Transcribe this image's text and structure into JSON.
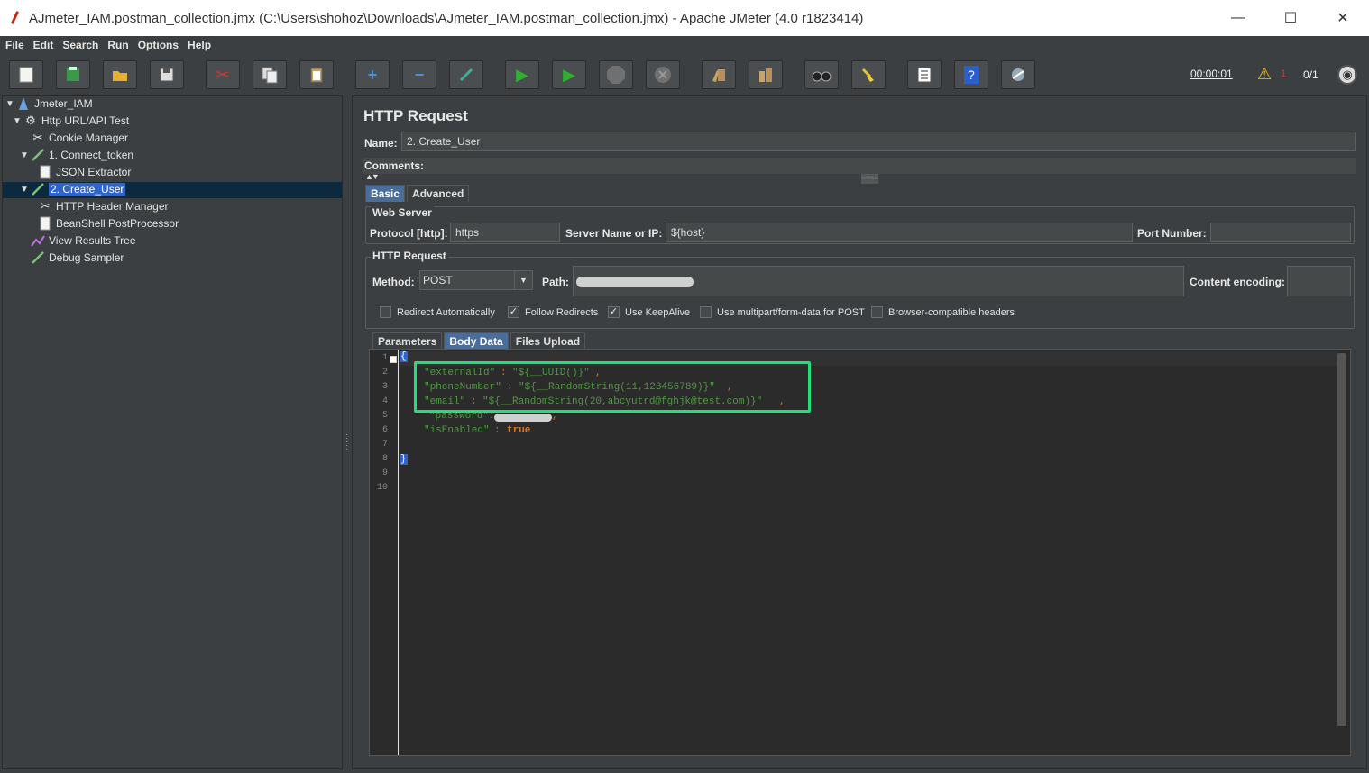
{
  "window": {
    "title": "AJmeter_IAM.postman_collection.jmx (C:\\Users\\shohoz\\Downloads\\AJmeter_IAM.postman_collection.jmx) - Apache JMeter (4.0 r1823414)",
    "minimize": "—",
    "maximize": "☐",
    "close": "✕"
  },
  "menu": [
    "File",
    "Edit",
    "Search",
    "Run",
    "Options",
    "Help"
  ],
  "toolbar": {
    "timer": "00:00:01",
    "error_count": "1",
    "threads": "0/1"
  },
  "tree": {
    "items": [
      {
        "label": "Jmeter_IAM",
        "icon": "testplan-icon"
      },
      {
        "label": "Http URL/API Test",
        "icon": "threadgroup-gear-icon"
      },
      {
        "label": "Cookie Manager",
        "icon": "config-scissors-icon"
      },
      {
        "label": "1. Connect_token",
        "icon": "sampler-pipette-icon"
      },
      {
        "label": "JSON Extractor",
        "icon": "postprocessor-doc-icon"
      },
      {
        "label": "2. Create_User",
        "icon": "sampler-pipette-icon"
      },
      {
        "label": "HTTP Header Manager",
        "icon": "config-scissors-icon"
      },
      {
        "label": "BeanShell PostProcessor",
        "icon": "postprocessor-doc-icon"
      },
      {
        "label": "View Results Tree",
        "icon": "listener-chart-icon"
      },
      {
        "label": "Debug Sampler",
        "icon": "sampler-pipette-icon"
      }
    ]
  },
  "panel": {
    "title": "HTTP Request",
    "name_label": "Name:",
    "name_value": "2. Create_User",
    "comments_label": "Comments:",
    "tabs": [
      "Basic",
      "Advanced"
    ],
    "web_server": {
      "title": "Web Server",
      "protocol_label": "Protocol [http]:",
      "protocol_value": "https",
      "server_label": "Server Name or IP:",
      "server_value": "${host}",
      "port_label": "Port Number:",
      "port_value": ""
    },
    "http_request": {
      "title": "HTTP Request",
      "method_label": "Method:",
      "method_value": "POST",
      "path_label": "Path:",
      "encoding_label": "Content encoding:"
    },
    "checkboxes": [
      {
        "label": "Redirect Automatically",
        "checked": false
      },
      {
        "label": "Follow Redirects",
        "checked": true
      },
      {
        "label": "Use KeepAlive",
        "checked": true
      },
      {
        "label": "Use multipart/form-data for POST",
        "checked": false
      },
      {
        "label": "Browser-compatible headers",
        "checked": false
      }
    ],
    "body_tabs": [
      "Parameters",
      "Body Data",
      "Files Upload"
    ],
    "body_lines": [
      "1",
      "2",
      "3",
      "4",
      "5",
      "6",
      "7",
      "8",
      "9",
      "10"
    ],
    "body": {
      "l1": "{",
      "l2_key": "\"externalId\"",
      "l2_val": "\"${__UUID()}\"",
      "l3_key": "\"phoneNumber\"",
      "l3_val": "\"${__RandomString(11,123456789)}\"",
      "l4_key": "\"email\"",
      "l4_val": "\"${__RandomString(20,abcyutrd@fghjk@test.com)}\"",
      "l5_key": "\"password\"",
      "l6_key": "\"isEnabled\"",
      "l6_val": "true",
      "l8": "}"
    }
  }
}
